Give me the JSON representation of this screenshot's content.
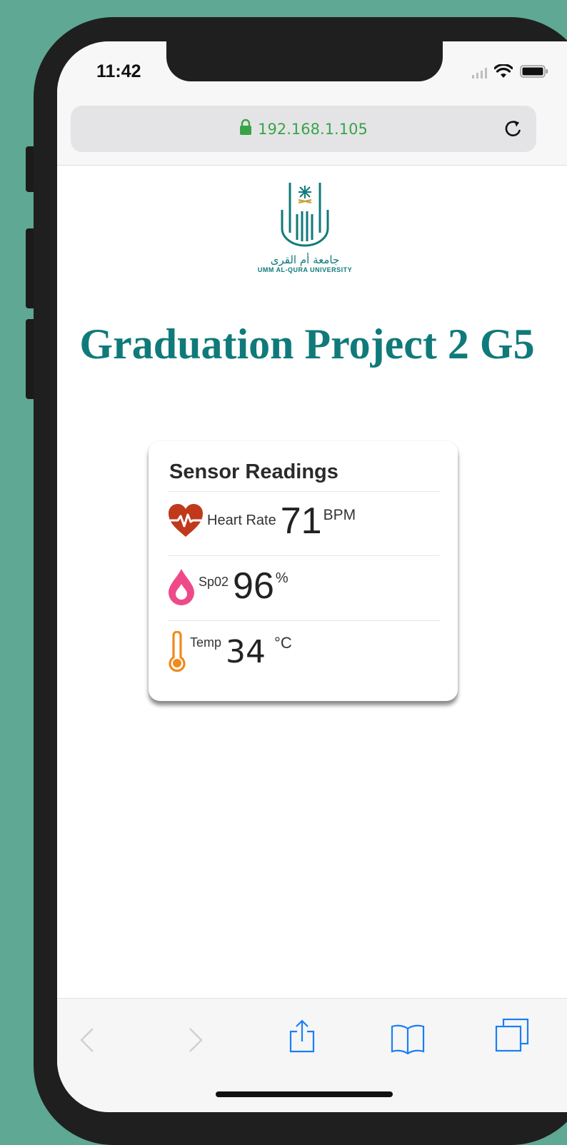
{
  "status_bar": {
    "time": "11:42"
  },
  "browser": {
    "url": "192.168.1.105",
    "lock_color": "#3aa349"
  },
  "page": {
    "logo_arabic": "جامعة أم القرى",
    "logo_english": "UMM AL-QURA UNIVERSITY",
    "title": "Graduation Project 2 G5",
    "accent_color": "#107a7a"
  },
  "card": {
    "title": "Sensor Readings",
    "readings": [
      {
        "icon": "heart-rate-icon",
        "label": "Heart Rate",
        "value": "71",
        "unit": "BPM",
        "color": "#c0391b"
      },
      {
        "icon": "blood-drop-icon",
        "label": "Sp02",
        "value": "96",
        "unit": "%",
        "color": "#ee4a8a"
      },
      {
        "icon": "thermometer-icon",
        "label": "Temp",
        "value": "34",
        "unit": "°C",
        "color": "#f08a1c"
      }
    ]
  },
  "toolbar": {
    "icons": [
      "back-icon",
      "forward-icon",
      "share-icon",
      "bookmarks-icon",
      "tabs-icon"
    ]
  }
}
